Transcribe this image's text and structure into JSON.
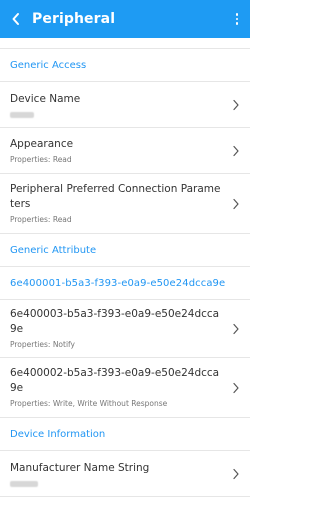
{
  "appbar": {
    "title": "Peripheral",
    "back_icon": "chevron-left-icon",
    "more_icon": "more-vertical-icon",
    "color": "#1e9bf3"
  },
  "services": [
    {
      "header": "Generic Access",
      "characteristics": [
        {
          "name": "Device Name",
          "properties": "",
          "value_redacted": true
        },
        {
          "name": "Appearance",
          "properties": "Properties: Read"
        },
        {
          "name": "Peripheral Preferred Connection Parameters",
          "properties": "Properties: Read"
        }
      ]
    },
    {
      "header": "Generic Attribute",
      "characteristics": []
    },
    {
      "header": "6e400001-b5a3-f393-e0a9-e50e24dcca9e",
      "characteristics": [
        {
          "name": "6e400003-b5a3-f393-e0a9-e50e24dcca9e",
          "properties": "Properties: Notify"
        },
        {
          "name": "6e400002-b5a3-f393-e0a9-e50e24dcca9e",
          "properties": "Properties: Write, Write Without Response"
        }
      ]
    },
    {
      "header": "Device Information",
      "characteristics": [
        {
          "name": "Manufacturer Name String",
          "properties": "",
          "value_redacted": true
        }
      ]
    }
  ],
  "colors": {
    "accent": "#2196f3",
    "divider": "#e6e6e6",
    "text": "#333333",
    "subtext": "#777777"
  }
}
